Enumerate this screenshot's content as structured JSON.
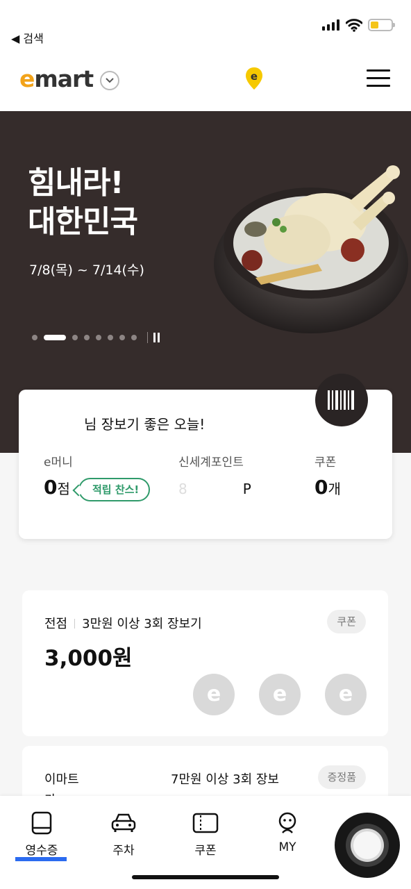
{
  "status_bar": {
    "back_label": "◀ 검색"
  },
  "header": {
    "logo_e": "e",
    "logo_rest": "mart"
  },
  "banner": {
    "title_line1": "힘내라!",
    "title_line2": "대한민국",
    "date": "7/8(목) ~ 7/14(수)",
    "slide_count": 9,
    "active_slide": 2
  },
  "account": {
    "greeting": "님 장보기 좋은 오늘!",
    "emoney_label": "e머니",
    "emoney_value": "0",
    "emoney_unit": "점",
    "earn_chip": "적립 찬스!",
    "points_label": "신세계포인트",
    "points_value": "8",
    "points_unit": "P",
    "coupon_label": "쿠폰",
    "coupon_value": "0",
    "coupon_unit": "개"
  },
  "promos": [
    {
      "store": "전점",
      "desc": "3만원 이상 3회 장보기",
      "amount": "3,000원",
      "tag": "쿠폰",
      "stamps": 3
    },
    {
      "store": "이마트",
      "store_line2": "가",
      "desc": "7만원 이상 3회 장보",
      "tag": "증정품"
    }
  ],
  "tabbar": {
    "items": [
      {
        "label": "영수증",
        "icon": "receipt-icon"
      },
      {
        "label": "주차",
        "icon": "car-icon"
      },
      {
        "label": "쿠폰",
        "icon": "ticket-icon"
      },
      {
        "label": "MY",
        "icon": "profile-icon"
      }
    ],
    "active": 0
  },
  "colors": {
    "brand_yellow": "#f2a31a",
    "banner_bg": "#352c2b",
    "green": "#2f9a6a",
    "tab_indicator": "#2b6bf0"
  }
}
